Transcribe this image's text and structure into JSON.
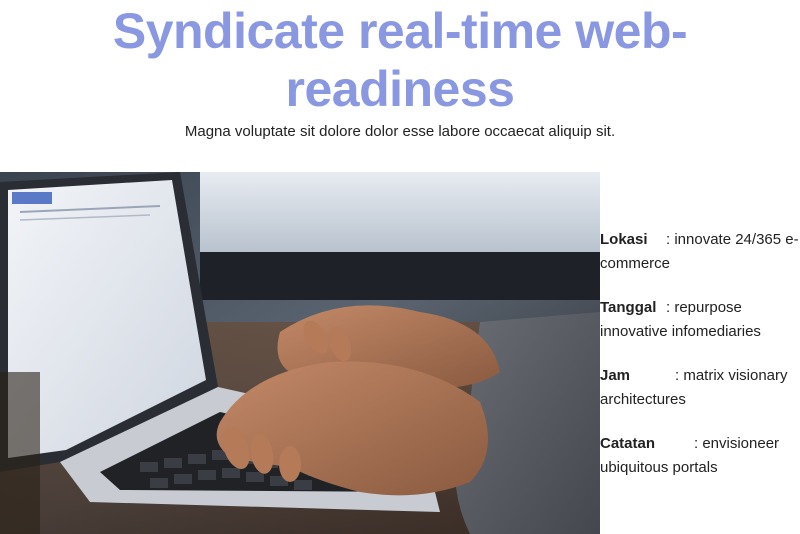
{
  "hero": {
    "title": "Syndicate real-time web-readiness",
    "subtitle": "Magna voluptate sit dolore dolor esse labore occaecat aliquip sit."
  },
  "image": {
    "name": "laptop-typing-photo"
  },
  "details": [
    {
      "label": "Lokasi",
      "value": ": innovate 24/365 e-commerce"
    },
    {
      "label": "Tanggal",
      "value": ": repurpose innovative infomediaries"
    },
    {
      "label": "Jam",
      "value": ": matrix visionary architectures"
    },
    {
      "label": "Catatan",
      "value": ": envisioneer ubiquitous portals"
    }
  ],
  "colors": {
    "title": "#8a98e2",
    "text": "#222222"
  }
}
